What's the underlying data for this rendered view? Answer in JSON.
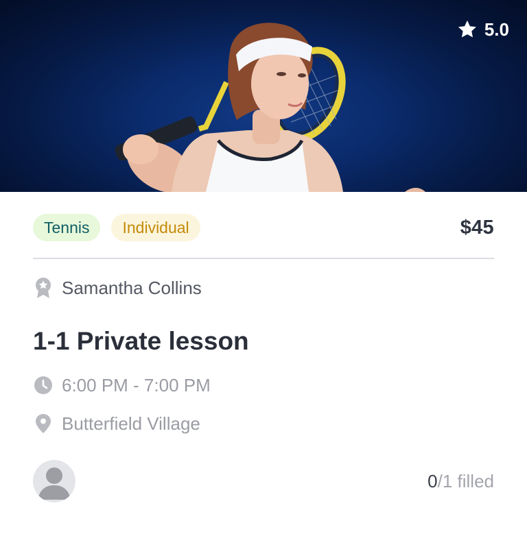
{
  "card": {
    "rating": "5.0",
    "tags": {
      "sport": "Tennis",
      "type": "Individual"
    },
    "price": "$45",
    "coach_name": "Samantha Collins",
    "title": "1-1 Private lesson",
    "time": "6:00 PM - 7:00 PM",
    "location": "Butterfield Village",
    "capacity": {
      "filled": "0",
      "rest": "/1 filled"
    }
  },
  "icons": {
    "rating": "star-icon",
    "coach": "award-badge-icon",
    "time": "clock-icon",
    "location": "map-pin-icon",
    "avatar": "user-avatar-icon"
  },
  "colors": {
    "hero_background": "#0a2a6a",
    "tag_sport_bg": "#e8f8da",
    "tag_sport_text": "#0f5f66",
    "tag_type_bg": "#fbf5dd",
    "tag_type_text": "#c58a07",
    "text_dark": "#2b2f3a",
    "text_muted": "#9a9ca3"
  }
}
